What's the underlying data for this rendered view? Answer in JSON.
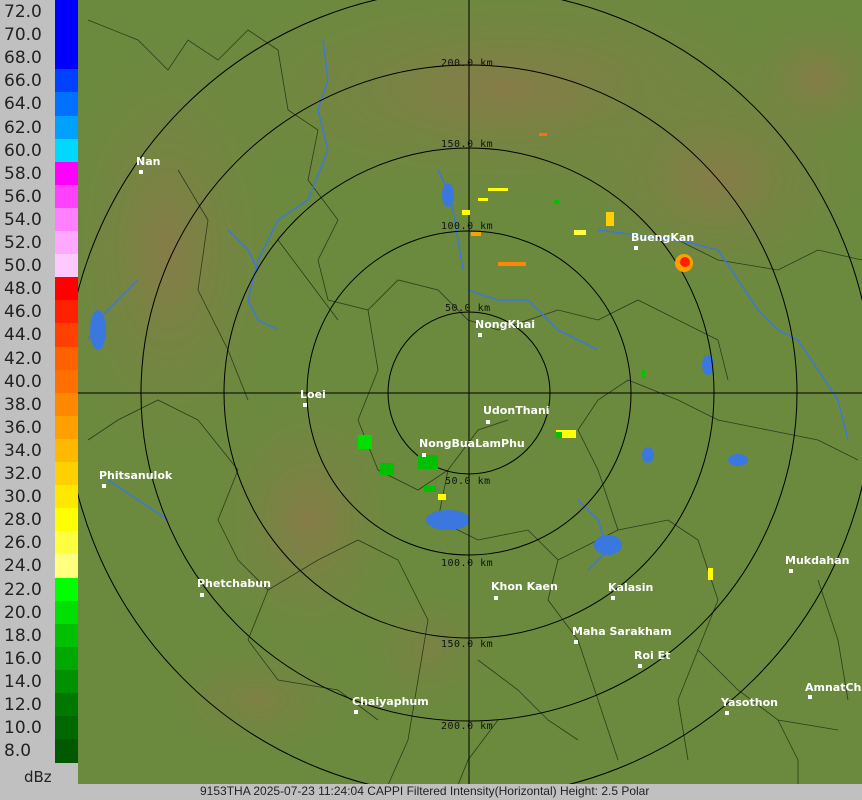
{
  "legend": {
    "unit": "dBz",
    "levels": [
      {
        "label": "72.0",
        "color": "#0000ff"
      },
      {
        "label": "70.0",
        "color": "#0000ff"
      },
      {
        "label": "68.0",
        "color": "#0000ff"
      },
      {
        "label": "66.0",
        "color": "#0040ff"
      },
      {
        "label": "64.0",
        "color": "#0070ff"
      },
      {
        "label": "62.0",
        "color": "#00a0ff"
      },
      {
        "label": "60.0",
        "color": "#00d8ff"
      },
      {
        "label": "58.0",
        "color": "#ff00ff"
      },
      {
        "label": "56.0",
        "color": "#ff40ff"
      },
      {
        "label": "54.0",
        "color": "#ff80ff"
      },
      {
        "label": "52.0",
        "color": "#ffa8ff"
      },
      {
        "label": "50.0",
        "color": "#ffc8ff"
      },
      {
        "label": "48.0",
        "color": "#ff0000"
      },
      {
        "label": "46.0",
        "color": "#ff2000"
      },
      {
        "label": "44.0",
        "color": "#ff4000"
      },
      {
        "label": "42.0",
        "color": "#ff6000"
      },
      {
        "label": "40.0",
        "color": "#ff7000"
      },
      {
        "label": "38.0",
        "color": "#ff8800"
      },
      {
        "label": "36.0",
        "color": "#ffa000"
      },
      {
        "label": "34.0",
        "color": "#ffb800"
      },
      {
        "label": "32.0",
        "color": "#ffd000"
      },
      {
        "label": "30.0",
        "color": "#ffe800"
      },
      {
        "label": "28.0",
        "color": "#ffff00"
      },
      {
        "label": "26.0",
        "color": "#ffff40"
      },
      {
        "label": "24.0",
        "color": "#ffff80"
      },
      {
        "label": "22.0",
        "color": "#00ff00"
      },
      {
        "label": "20.0",
        "color": "#00e000"
      },
      {
        "label": "18.0",
        "color": "#00c000"
      },
      {
        "label": "16.0",
        "color": "#00a800"
      },
      {
        "label": "14.0",
        "color": "#009000"
      },
      {
        "label": "12.0",
        "color": "#007800"
      },
      {
        "label": "10.0",
        "color": "#006800"
      },
      {
        "label": "8.0",
        "color": "#005800"
      }
    ]
  },
  "rings": [
    {
      "label": "50.0 km"
    },
    {
      "label": "100.0 km"
    },
    {
      "label": "150.0 km"
    },
    {
      "label": "200.0 km"
    }
  ],
  "cities": [
    {
      "name": "Nan"
    },
    {
      "name": "NongKhai"
    },
    {
      "name": "BuengKan"
    },
    {
      "name": "Loei"
    },
    {
      "name": "UdonThani"
    },
    {
      "name": "NongBuaLamPhu"
    },
    {
      "name": "Phitsanulok"
    },
    {
      "name": "Phetchabun"
    },
    {
      "name": "Khon Kaen"
    },
    {
      "name": "Kalasin"
    },
    {
      "name": "Maha Sarakham"
    },
    {
      "name": "Roi Et"
    },
    {
      "name": "Mukdahan"
    },
    {
      "name": "Chaiyaphum"
    },
    {
      "name": "Yasothon"
    },
    {
      "name": "AmnatCha"
    }
  ],
  "status": "9153THA 2025-07-23 11:24:04 CAPPI Filtered Intensity(Horizontal)  Height: 2.5 Polar",
  "colors": {
    "terrain_low": "#6b8a3e",
    "terrain_high": "#7c6a3a",
    "river": "#3a78e0"
  }
}
